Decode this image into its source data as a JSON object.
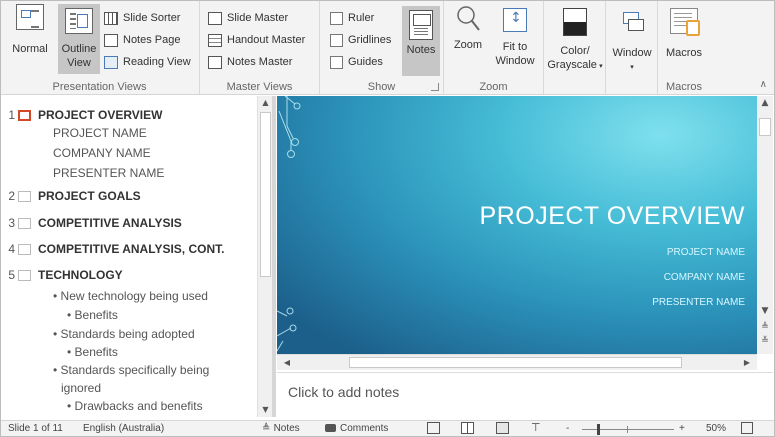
{
  "ribbon": {
    "presentation_views": {
      "label": "Presentation Views",
      "normal": "Normal",
      "outline_line1": "Outline",
      "outline_line2": "View",
      "slide_sorter": "Slide Sorter",
      "notes_page": "Notes Page",
      "reading_view": "Reading View"
    },
    "master_views": {
      "label": "Master Views",
      "slide_master": "Slide Master",
      "handout_master": "Handout Master",
      "notes_master": "Notes Master"
    },
    "show": {
      "label": "Show",
      "ruler": "Ruler",
      "gridlines": "Gridlines",
      "guides": "Guides",
      "notes": "Notes"
    },
    "zoom": {
      "label": "Zoom",
      "zoom": "Zoom",
      "fit_line1": "Fit to",
      "fit_line2": "Window"
    },
    "color": {
      "line1": "Color/",
      "line2": "Grayscale"
    },
    "window": {
      "label": "Window"
    },
    "macros": {
      "label": "Macros",
      "button": "Macros"
    }
  },
  "outline": {
    "slides": [
      {
        "num": "1",
        "title": "PROJECT OVERVIEW",
        "selected": true
      },
      {
        "num": "2",
        "title": "PROJECT GOALS"
      },
      {
        "num": "3",
        "title": "COMPETITIVE ANALYSIS"
      },
      {
        "num": "4",
        "title": "COMPETITIVE ANALYSIS, CONT."
      },
      {
        "num": "5",
        "title": "TECHNOLOGY"
      }
    ],
    "slide1_lines": [
      "PROJECT NAME",
      "COMPANY NAME",
      "PRESENTER NAME"
    ],
    "slide5_lines": [
      "• New technology being used",
      "• Benefits",
      "• Standards being adopted",
      "• Benefits",
      "• Standards specifically being",
      "ignored",
      "• Drawbacks and benefits"
    ]
  },
  "slide": {
    "title": "PROJECT OVERVIEW",
    "project_name": "PROJECT NAME",
    "company_name": "COMPANY NAME",
    "presenter_name": "PRESENTER NAME"
  },
  "notes": {
    "placeholder": "Click to add notes"
  },
  "status": {
    "slide_count": "Slide 1 of 11",
    "language": "English (Australia)",
    "notes": "Notes",
    "comments": "Comments",
    "zoom_minus": "-",
    "zoom_plus": "+",
    "zoom_level": "50%"
  },
  "colors": {
    "accent": "#d24726",
    "slide_bg": "#2a8fb7"
  }
}
